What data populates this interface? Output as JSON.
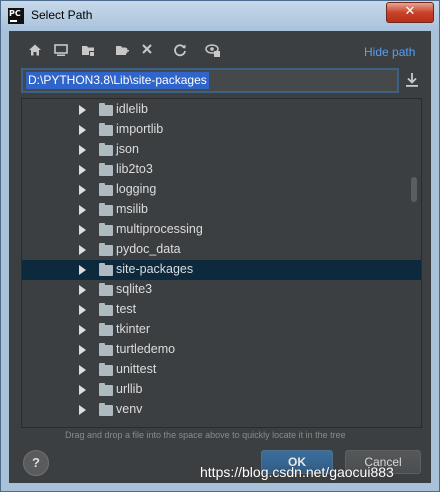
{
  "window": {
    "title": "Select Path",
    "app_icon_text": "PC",
    "close_symbol": "✕"
  },
  "toolbar": {
    "icons": [
      "home-icon",
      "desktop-icon",
      "project-icon",
      "new-folder-icon",
      "delete-icon",
      "refresh-icon",
      "show-hidden-icon"
    ],
    "hide_path": "Hide path"
  },
  "path_field": {
    "value": "D:\\PYTHON3.8\\Lib\\site-packages"
  },
  "tree": {
    "items": [
      {
        "label": "idlelib"
      },
      {
        "label": "importlib"
      },
      {
        "label": "json"
      },
      {
        "label": "lib2to3"
      },
      {
        "label": "logging"
      },
      {
        "label": "msilib"
      },
      {
        "label": "multiprocessing"
      },
      {
        "label": "pydoc_data"
      },
      {
        "label": "site-packages",
        "selected": true
      },
      {
        "label": "sqlite3"
      },
      {
        "label": "test"
      },
      {
        "label": "tkinter"
      },
      {
        "label": "turtledemo"
      },
      {
        "label": "unittest"
      },
      {
        "label": "urllib"
      },
      {
        "label": "venv"
      }
    ]
  },
  "hint": "Drag and drop a file into the space above to quickly locate it in the tree",
  "buttons": {
    "help": "?",
    "ok": "OK",
    "cancel": "Cancel"
  },
  "watermark": "https://blog.csdn.net/gaocui883",
  "colors": {
    "selection": "#0d293e",
    "link": "#589df6",
    "background": "#3c3f41"
  }
}
